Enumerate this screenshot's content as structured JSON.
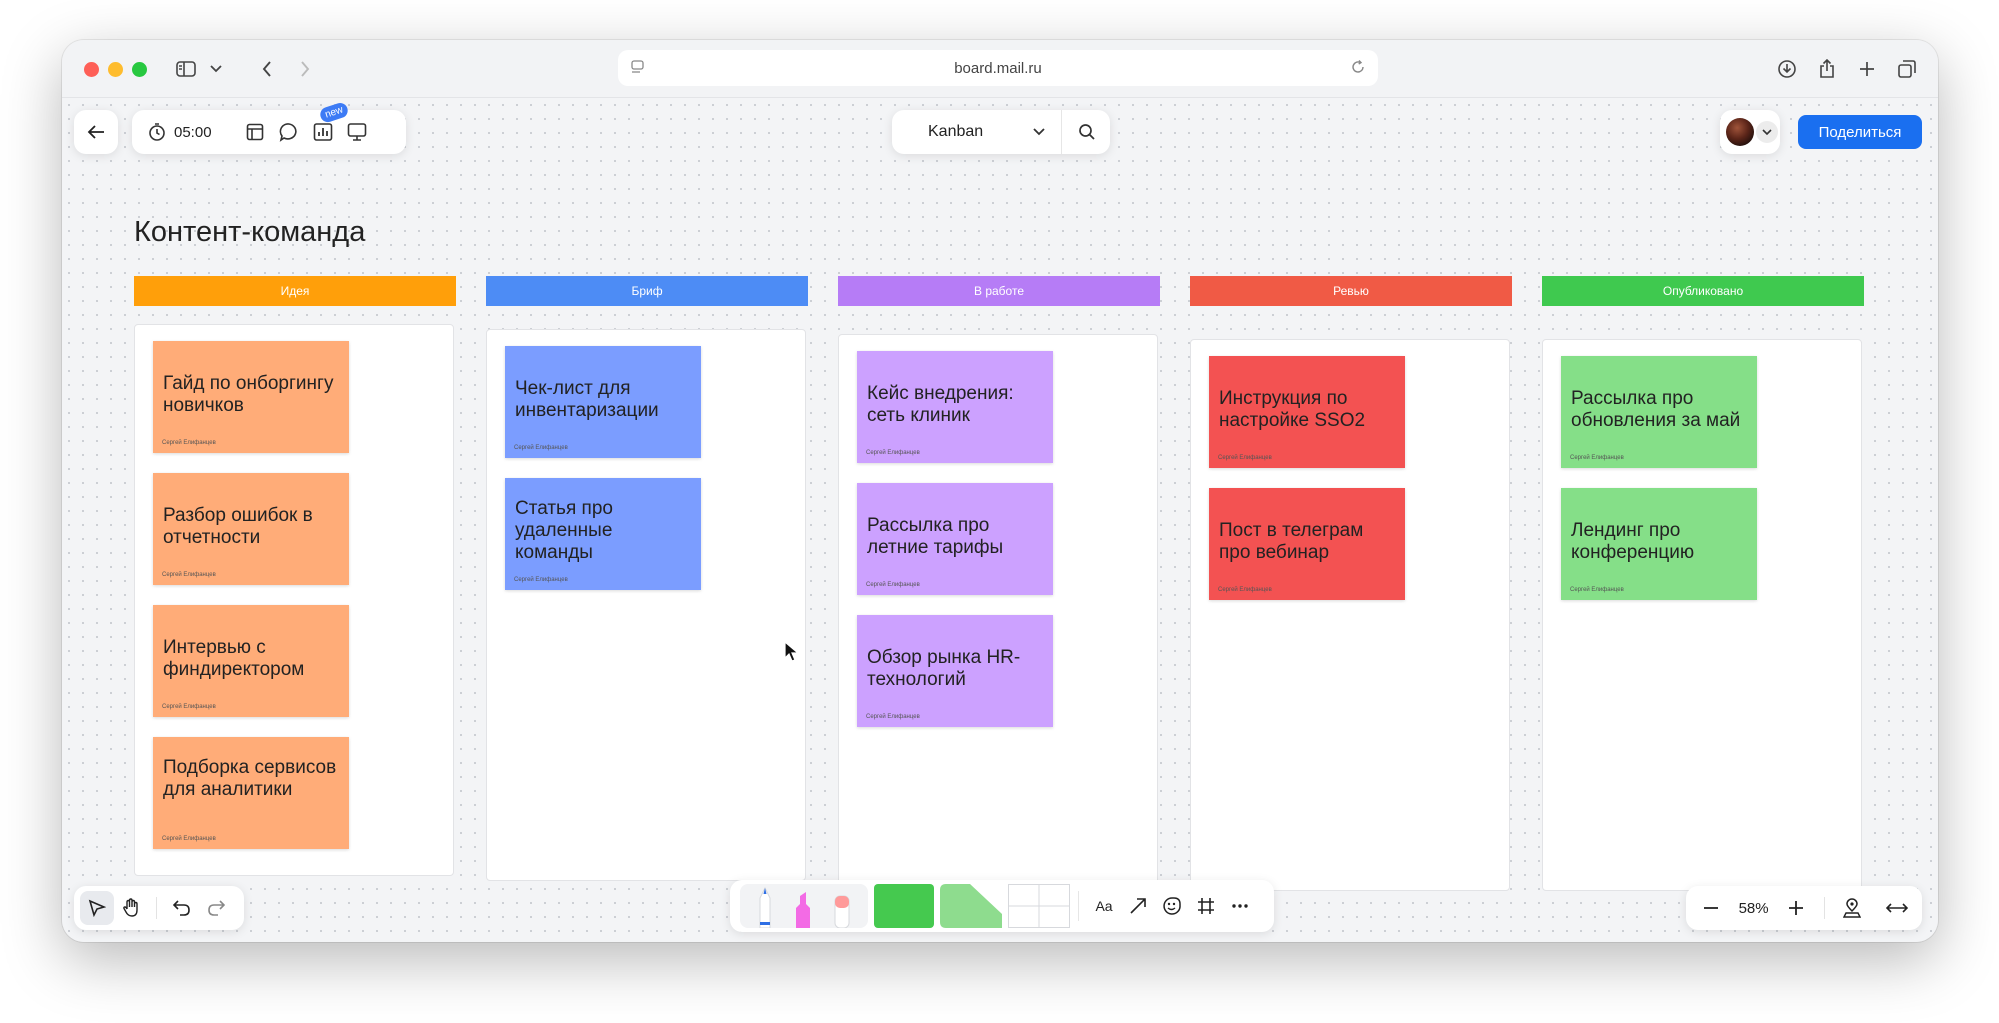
{
  "browser": {
    "url": "board.mail.ru"
  },
  "toolbar": {
    "timer": "05:00",
    "new_badge": "new",
    "view_select": "Kanban",
    "share_label": "Поделиться"
  },
  "board": {
    "title": "Контент-команда",
    "columns": [
      {
        "title": "Идея",
        "color": "#ff9f0a",
        "cards": [
          {
            "text": "Гайд по онборгингу новичков",
            "author": "Сергей Елифанцев"
          },
          {
            "text": "Разбор ошибок в отчетности",
            "author": "Сергей Елифанцев"
          },
          {
            "text": "Интервью с финдиректором",
            "author": "Сергей Елифанцев"
          },
          {
            "text": "Подборка сервисов для аналитики",
            "author": "Сергей Елифанцев"
          }
        ]
      },
      {
        "title": "Бриф",
        "color": "#4d8cf5",
        "cards": [
          {
            "text": "Чек-лист для инвентаризации",
            "author": "Сергей Елифанцев"
          },
          {
            "text": "Статья про удаленные команды",
            "author": "Сергей Елифанцев"
          }
        ]
      },
      {
        "title": "В работе",
        "color": "#b67cf6",
        "cards": [
          {
            "text": "Кейс внедрения: сеть клиник",
            "author": "Сергей Елифанцев"
          },
          {
            "text": "Рассылка про летние тарифы",
            "author": "Сергей Елифанцев"
          },
          {
            "text": "Обзор рынка HR-технологий",
            "author": "Сергей Елифанцев"
          }
        ]
      },
      {
        "title": "Ревью",
        "color": "#f05a45",
        "cards": [
          {
            "text": "Инструкция по настройке SSO2",
            "author": "Сергей Елифанцев"
          },
          {
            "text": "Пост в телеграм про вебинар",
            "author": "Сергей Елифанцев"
          }
        ]
      },
      {
        "title": "Опубликовано",
        "color": "#3fc94f",
        "cards": [
          {
            "text": "Рассылка про обновления за май",
            "author": "Сергей Елифанцев"
          },
          {
            "text": "Лендинг про конференцию",
            "author": "Сергей Елифанцев"
          }
        ]
      }
    ]
  },
  "bottom_toolbar": {
    "text_tool_label": "Aa"
  },
  "zoom": {
    "level": "58%"
  },
  "colors": {
    "sticky_orange": "#ffac78",
    "sticky_blue": "#7b9dff",
    "sticky_purple": "#cca1ff",
    "sticky_red": "#f35252",
    "sticky_green": "#85df88",
    "accent": "#1a6ff0"
  }
}
